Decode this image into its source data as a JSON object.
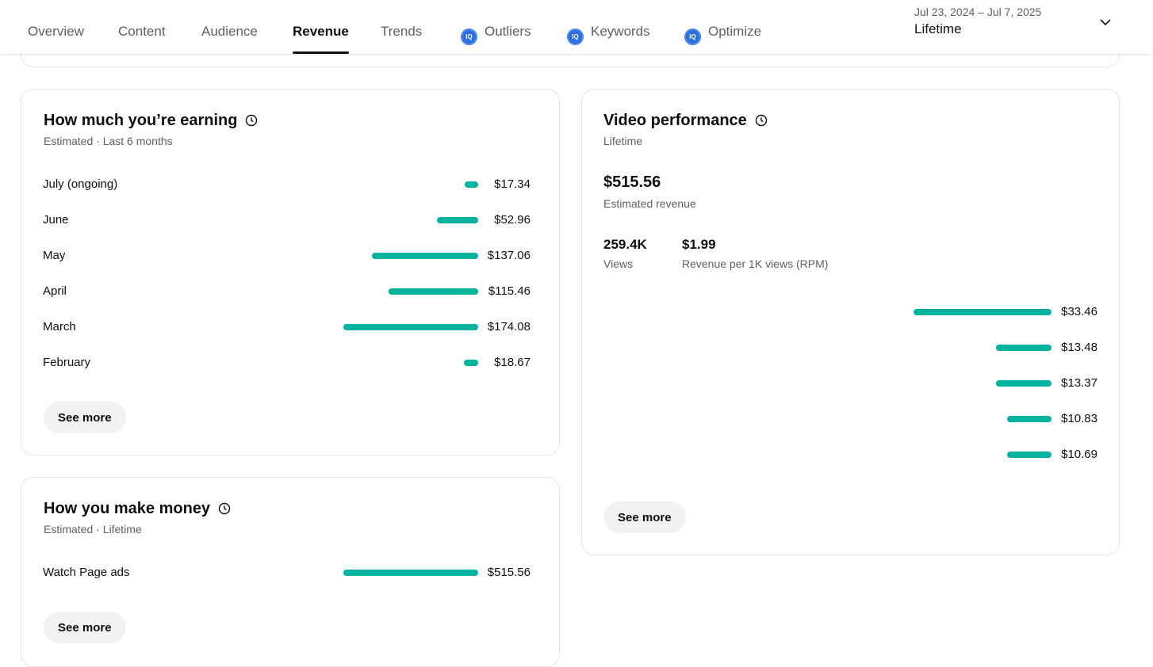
{
  "tabs": [
    {
      "label": "Overview",
      "active": false,
      "iq": false
    },
    {
      "label": "Content",
      "active": false,
      "iq": false
    },
    {
      "label": "Audience",
      "active": false,
      "iq": false
    },
    {
      "label": "Revenue",
      "active": true,
      "iq": false
    },
    {
      "label": "Trends",
      "active": false,
      "iq": false
    },
    {
      "label": "Outliers",
      "active": false,
      "iq": true
    },
    {
      "label": "Keywords",
      "active": false,
      "iq": true
    },
    {
      "label": "Optimize",
      "active": false,
      "iq": true
    }
  ],
  "iq_badge": "IQ",
  "date_picker": {
    "range": "Jul 23, 2024 – Jul 7, 2025",
    "label": "Lifetime"
  },
  "earning": {
    "title": "How much you’re earning",
    "subtitle": "Estimated · Last 6 months",
    "rows": [
      {
        "label": "July (ongoing)",
        "value": "$17.34",
        "amount": 17.34
      },
      {
        "label": "June",
        "value": "$52.96",
        "amount": 52.96
      },
      {
        "label": "May",
        "value": "$137.06",
        "amount": 137.06
      },
      {
        "label": "April",
        "value": "$115.46",
        "amount": 115.46
      },
      {
        "label": "March",
        "value": "$174.08",
        "amount": 174.08
      },
      {
        "label": "February",
        "value": "$18.67",
        "amount": 18.67
      }
    ],
    "see_more": "See more"
  },
  "make_money": {
    "title": "How you make money",
    "subtitle": "Estimated · Lifetime",
    "rows": [
      {
        "label": "Watch Page ads",
        "value": "$515.56",
        "amount": 515.56
      }
    ],
    "see_more": "See more"
  },
  "video_performance": {
    "title": "Video performance",
    "subtitle": "Lifetime",
    "revenue_value": "$515.56",
    "revenue_label": "Estimated revenue",
    "views_value": "259.4K",
    "views_label": "Views",
    "rpm_value": "$1.99",
    "rpm_label": "Revenue per 1K views (RPM)",
    "rows": [
      {
        "value": "$33.46",
        "amount": 33.46
      },
      {
        "value": "$13.48",
        "amount": 13.48
      },
      {
        "value": "$13.37",
        "amount": 13.37
      },
      {
        "value": "$10.83",
        "amount": 10.83
      },
      {
        "value": "$10.69",
        "amount": 10.69
      }
    ],
    "see_more": "See more"
  },
  "colors": {
    "bar": "#00b39f",
    "iq_icon": "#2b6fe0"
  }
}
